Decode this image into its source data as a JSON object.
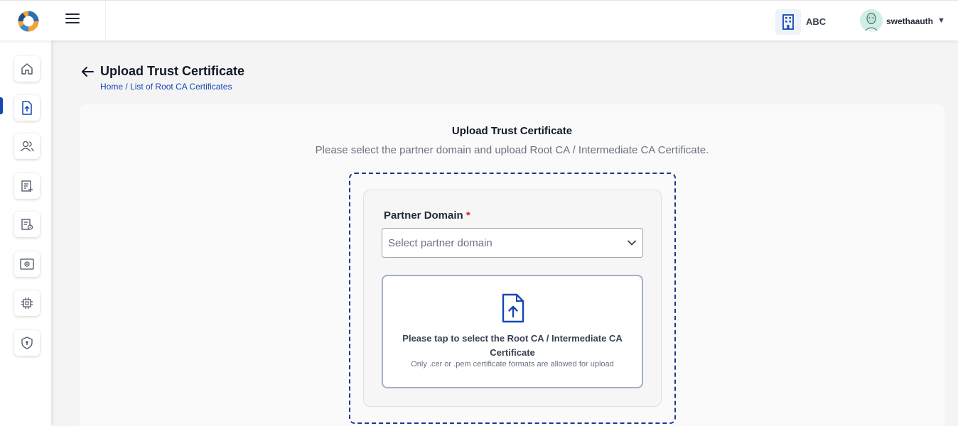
{
  "header": {
    "org_name": "ABC",
    "user_name": "swethaauth",
    "caret": "▼"
  },
  "sidebar": {
    "items": [
      {
        "name": "home-icon"
      },
      {
        "name": "upload-certificate-icon",
        "active": true
      },
      {
        "name": "partners-icon"
      },
      {
        "name": "policy-add-icon"
      },
      {
        "name": "policy-settings-icon"
      },
      {
        "name": "device-settings-icon"
      },
      {
        "name": "chip-icon"
      },
      {
        "name": "shield-lock-icon"
      }
    ]
  },
  "page": {
    "title": "Upload Trust Certificate",
    "breadcrumb_home": "Home",
    "breadcrumb_sep": "/",
    "breadcrumb_current": "List of Root CA Certificates"
  },
  "form": {
    "title": "Upload Trust Certificate",
    "subtitle": "Please select the partner domain and upload Root CA / Intermediate CA Certificate.",
    "partner_domain_label": "Partner Domain",
    "required_mark": "*",
    "select_placeholder": "Select partner domain",
    "upload_main": "Please tap to select the Root CA / Intermediate CA Certificate",
    "upload_hint": "Only .cer or .pem certificate formats are allowed for upload"
  },
  "colors": {
    "accent": "#1447b2",
    "required": "#dc2626"
  }
}
